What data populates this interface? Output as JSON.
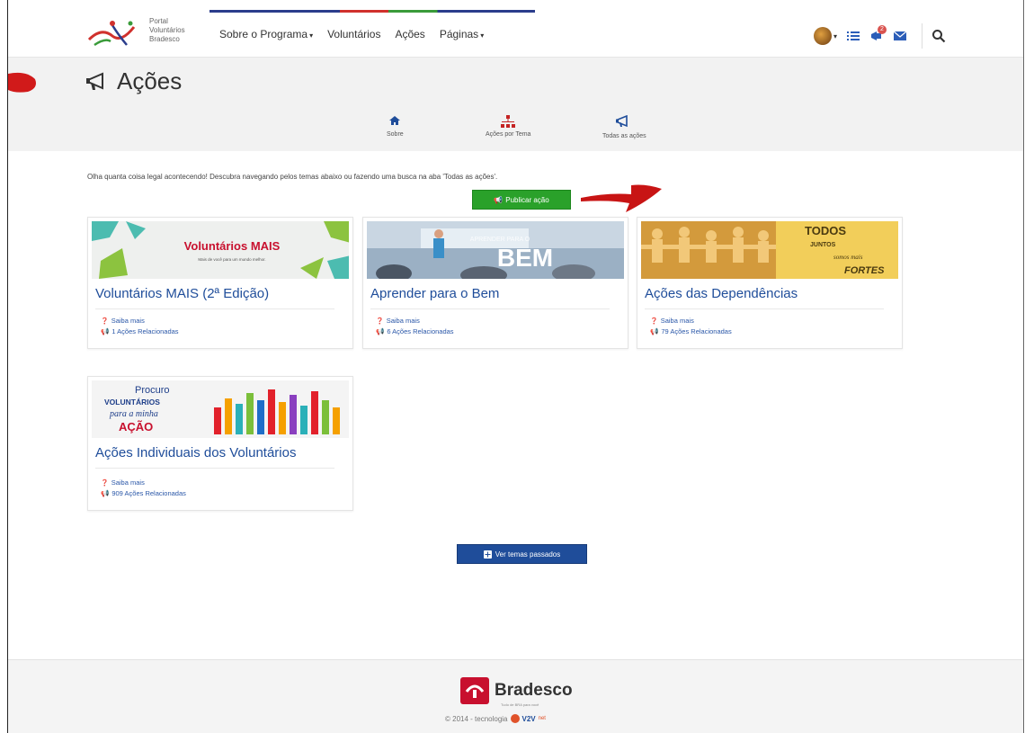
{
  "nav": {
    "logo_text": [
      "Portal",
      "Voluntários",
      "Bradesco"
    ],
    "links": [
      "Sobre o Programa",
      "Voluntários",
      "Ações",
      "Páginas"
    ],
    "notification_count": "2"
  },
  "header": {
    "title": "Ações",
    "subnav": [
      "Sobre",
      "Ações por Tema",
      "Todas as ações"
    ]
  },
  "main": {
    "intro": "Olha quanta coisa legal acontecendo! Descubra navegando pelos temas abaixo ou fazendo uma busca na aba 'Todas as ações'.",
    "publish_button": "Publicar ação",
    "past_button": "Ver temas passados",
    "cards": [
      {
        "banner_title": "Voluntários MAIS",
        "banner_sub": "Mais de você para um mundo melhor.",
        "title": "Voluntários MAIS (2ª Edição)",
        "more": "Saiba mais",
        "related": "1 Ações Relacionadas"
      },
      {
        "banner_small": "APRENDER PARA O",
        "banner_big": "BEM",
        "title": "Aprender para o Bem",
        "more": "Saiba mais",
        "related": "6 Ações Relacionadas"
      },
      {
        "banner_lines": [
          "TODOS",
          "JUNTOS",
          "somos mais",
          "FORTES"
        ],
        "title": "Ações das Dependências",
        "more": "Saiba mais",
        "related": "79 Ações Relacionadas"
      },
      {
        "banner_lines": [
          "Procuro",
          "VOLUNTÁRIOS",
          "para a minha",
          "AÇÃO"
        ],
        "title": "Ações Individuais dos Voluntários",
        "more": "Saiba mais",
        "related": "909 Ações Relacionadas"
      }
    ]
  },
  "footer": {
    "brand": "Bradesco",
    "tagline": "Tudo de BRA para você",
    "copyright": "© 2014 - tecnologia",
    "v2v": "V2V",
    "v2v_suffix": "net"
  }
}
